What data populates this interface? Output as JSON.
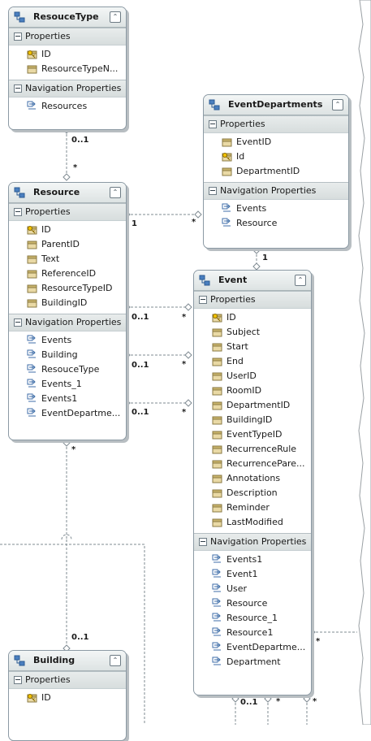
{
  "icons": {
    "entity": "entity-icon",
    "key_property": "key-property-icon",
    "property": "property-icon",
    "navigation": "navigation-property-icon"
  },
  "colors": {
    "entity_border": "#8c9aa4",
    "header_bg": "#dde3e3",
    "connector": "#7f8b92"
  },
  "entities": {
    "resoucetype": {
      "title": "ResouceType",
      "collapse_glyph": "⌃",
      "properties_label": "Properties",
      "properties": [
        "ID",
        "ResourceTypeN..."
      ],
      "navigation_label": "Navigation Properties",
      "navigation": [
        "Resources"
      ]
    },
    "eventdepartments": {
      "title": "EventDepartments",
      "collapse_glyph": "⌃",
      "properties_label": "Properties",
      "properties": [
        "EventID",
        "Id",
        "DepartmentID"
      ],
      "navigation_label": "Navigation Properties",
      "navigation": [
        "Events",
        "Resource"
      ]
    },
    "resource": {
      "title": "Resource",
      "collapse_glyph": "⌃",
      "properties_label": "Properties",
      "properties": [
        "ID",
        "ParentID",
        "Text",
        "ReferenceID",
        "ResourceTypeID",
        "BuildingID"
      ],
      "navigation_label": "Navigation Properties",
      "navigation": [
        "Events",
        "Building",
        "ResouceType",
        "Events_1",
        "Events1",
        "EventDepartme..."
      ]
    },
    "event": {
      "title": "Event",
      "collapse_glyph": "⌃",
      "properties_label": "Properties",
      "properties": [
        "ID",
        "Subject",
        "Start",
        "End",
        "UserID",
        "RoomID",
        "DepartmentID",
        "BuildingID",
        "EventTypeID",
        "RecurrenceRule",
        "RecurrencePare...",
        "Annotations",
        "Description",
        "Reminder",
        "LastModified"
      ],
      "navigation_label": "Navigation Properties",
      "navigation": [
        "Events1",
        "Event1",
        "User",
        "Resource",
        "Resource_1",
        "Resource1",
        "EventDepartme...",
        "Department"
      ]
    },
    "building": {
      "title": "Building",
      "collapse_glyph": "⌃",
      "properties_label": "Properties",
      "properties": [
        "ID"
      ],
      "navigation_label": "",
      "navigation": []
    }
  },
  "multiplicities": {
    "resoucetype_resource_top": "0..1",
    "resoucetype_resource_bottom": "*",
    "resource_eventdept_left": "1",
    "resource_eventdept_right": "*",
    "eventdept_event_top": "1",
    "resource_event_1_left": "0..1",
    "resource_event_1_right": "*",
    "resource_event_2_left": "0..1",
    "resource_event_2_right": "*",
    "resource_event_3_left": "0..1",
    "resource_event_3_right": "*",
    "resource_building_top": "*",
    "resource_building_bottom": "0..1",
    "event_right_edge": "*",
    "event_bottom_a": "0..1",
    "event_bottom_b": "*",
    "event_bottom_c": "*"
  }
}
